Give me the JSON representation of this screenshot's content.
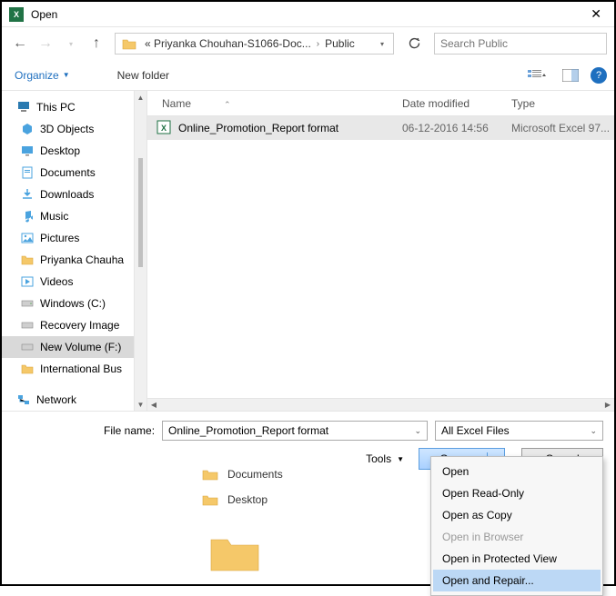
{
  "window": {
    "title": "Open"
  },
  "nav": {
    "crumb1": "« Priyanka Chouhan-S1066-Doc...",
    "crumb2": "Public"
  },
  "search": {
    "placeholder": "Search Public"
  },
  "toolbar": {
    "organize": "Organize",
    "newfolder": "New folder"
  },
  "tree": {
    "root": "This PC",
    "items": [
      "3D Objects",
      "Desktop",
      "Documents",
      "Downloads",
      "Music",
      "Pictures",
      "Priyanka Chauha",
      "Videos",
      "Windows (C:)",
      "Recovery Image",
      "New Volume (F:)",
      "International Bus"
    ],
    "network": "Network"
  },
  "columns": {
    "name": "Name",
    "date": "Date modified",
    "type": "Type"
  },
  "file": {
    "name": "Online_Promotion_Report  format",
    "date": "06-12-2016 14:56",
    "type": "Microsoft Excel 97..."
  },
  "bottom": {
    "filename_label": "File name:",
    "filename_value": "Online_Promotion_Report  format",
    "filetype": "All Excel Files",
    "tools": "Tools",
    "open": "Open",
    "cancel": "Cancel"
  },
  "menu": {
    "open": "Open",
    "readonly": "Open Read-Only",
    "copy": "Open as Copy",
    "browser": "Open in Browser",
    "protected": "Open in Protected View",
    "repair": "Open and Repair..."
  },
  "behind": {
    "docs": "Documents",
    "desk": "Desktop"
  }
}
